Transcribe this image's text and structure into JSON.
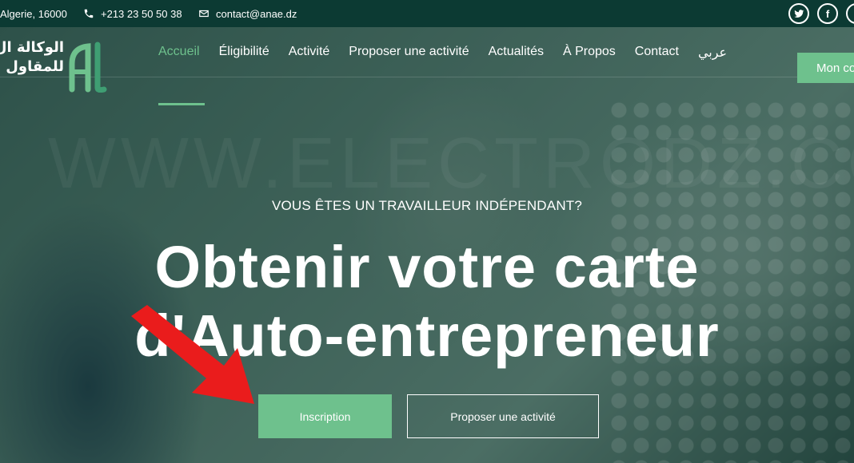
{
  "topbar": {
    "address": "Algerie, 16000",
    "phone": "+213 23 50 50 38",
    "email": "contact@anae.dz",
    "social": [
      "twitter-icon",
      "facebook-icon",
      "instagram-icon"
    ]
  },
  "logo": {
    "line1": "الوكالة ال",
    "line2": "للمقاول"
  },
  "nav": {
    "items": [
      {
        "label": "Accueil",
        "active": true
      },
      {
        "label": "Éligibilité"
      },
      {
        "label": "Activité"
      },
      {
        "label": "Proposer une activité"
      },
      {
        "label": "Actualités"
      },
      {
        "label": "À Propos"
      },
      {
        "label": "Contact"
      },
      {
        "label": "عربي"
      }
    ],
    "account_button": "Mon co"
  },
  "hero": {
    "watermark": "WWW.ELECTRODZ.COM",
    "subtitle": "VOUS ÊTES UN TRAVAILLEUR INDÉPENDANT?",
    "headline_line1": "Obtenir votre carte",
    "headline_line2": "d'Auto-entrepreneur",
    "cta_primary": "Inscription",
    "cta_secondary": "Proposer une activité"
  },
  "colors": {
    "topbar": "#0c3a33",
    "accent": "#6ec18d",
    "annotation_arrow": "#ea1c1c"
  }
}
